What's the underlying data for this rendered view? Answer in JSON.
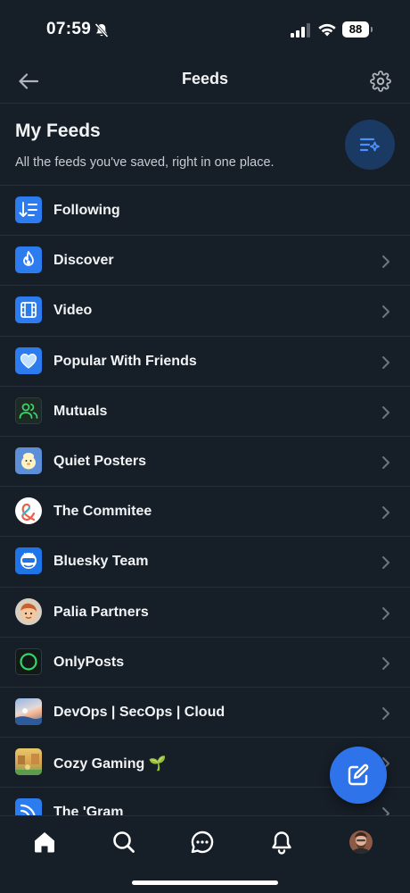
{
  "status_bar": {
    "time": "07:59",
    "battery": "88"
  },
  "header": {
    "title": "Feeds"
  },
  "section": {
    "title": "My Feeds",
    "subtitle": "All the feeds you've saved, right in one place."
  },
  "feeds": [
    {
      "label": "Following",
      "icon": "following-icon",
      "chevron": false
    },
    {
      "label": "Discover",
      "icon": "discover-icon",
      "chevron": true
    },
    {
      "label": "Video",
      "icon": "video-icon",
      "chevron": true
    },
    {
      "label": "Popular With Friends",
      "icon": "heart-icon",
      "chevron": true
    },
    {
      "label": "Mutuals",
      "icon": "mutuals-icon",
      "chevron": true
    },
    {
      "label": "Quiet Posters",
      "icon": "quiet-posters-avatar",
      "chevron": true
    },
    {
      "label": "The Commitee",
      "icon": "commitee-avatar",
      "chevron": true
    },
    {
      "label": "Bluesky Team",
      "icon": "bluesky-team-avatar",
      "chevron": true
    },
    {
      "label": "Palia Partners",
      "icon": "palia-partners-avatar",
      "chevron": true
    },
    {
      "label": "OnlyPosts",
      "icon": "onlyposts-avatar",
      "chevron": true
    },
    {
      "label": "DevOps | SecOps | Cloud",
      "icon": "devops-avatar",
      "chevron": true
    },
    {
      "label": "Cozy Gaming 🌱",
      "icon": "cozy-gaming-avatar",
      "chevron": true
    },
    {
      "label": "The 'Gram",
      "icon": "gram-avatar",
      "chevron": true
    }
  ],
  "colors": {
    "accent": "#2f73ea",
    "background": "#161e27",
    "divider": "#252f3b"
  }
}
